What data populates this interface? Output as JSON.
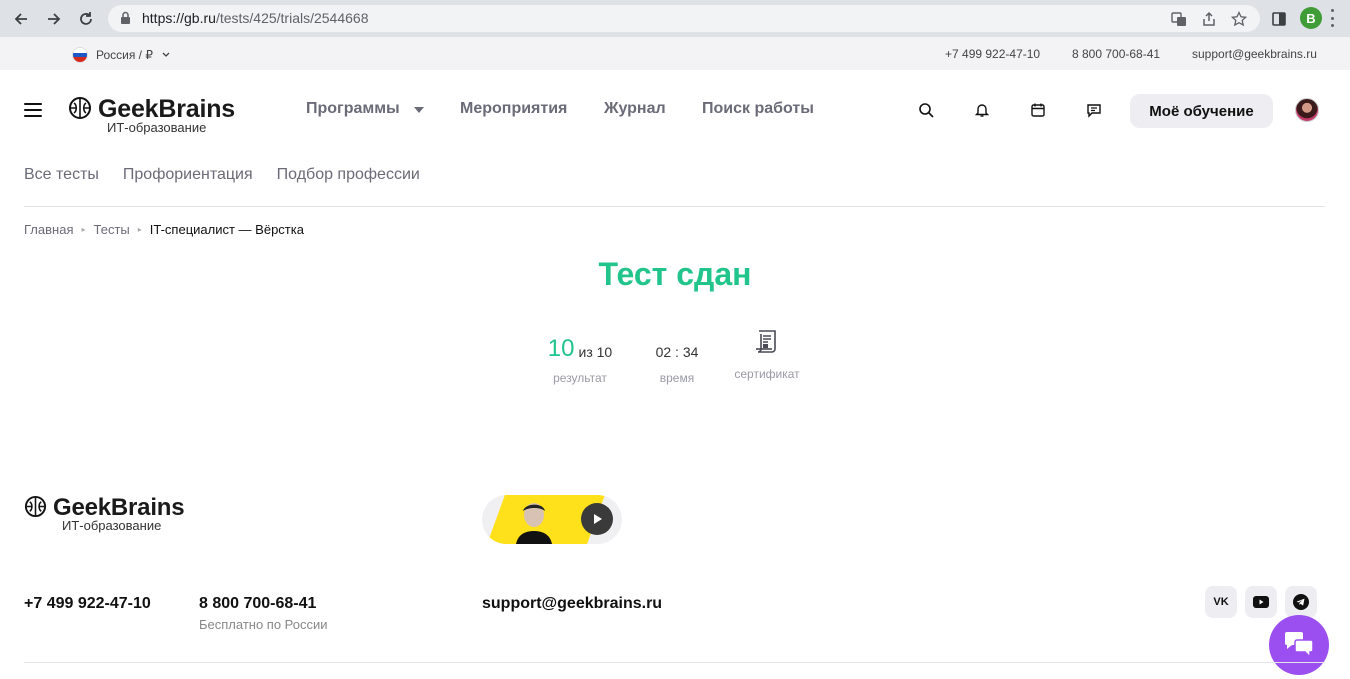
{
  "browser": {
    "url_host": "https://gb.ru",
    "url_path": "/tests/425/trials/2544668",
    "profile_initial": "B",
    "profile_color": "#3f9c36"
  },
  "topbar": {
    "region": "Россия / ₽",
    "phone1": "+7 499 922-47-10",
    "phone2": "8 800 700-68-41",
    "email": "support@geekbrains.ru"
  },
  "header": {
    "logo_name": "GeekBrains",
    "logo_tagline": "ИТ-образование",
    "nav": [
      "Программы",
      "Мероприятия",
      "Журнал",
      "Поиск работы"
    ],
    "my_learning": "Моё обучение",
    "icons": [
      "search-icon",
      "bell-icon",
      "calendar-icon",
      "message-icon"
    ]
  },
  "subnav": [
    "Все тесты",
    "Профориентация",
    "Подбор профессии"
  ],
  "breadcrumb": {
    "home": "Главная",
    "tests": "Тесты",
    "current": "IT-специалист — Вёрстка"
  },
  "result": {
    "title": "Тест сдан",
    "score": "10",
    "score_total": "из 10",
    "score_label": "результат",
    "time": "02 : 34",
    "time_label": "время",
    "certificate_label": "сертификат",
    "accent_color": "#21c48b"
  },
  "footer": {
    "logo_name": "GeekBrains",
    "logo_tagline": "ИТ-образование",
    "phone1": "+7 499 922-47-10",
    "phone2": "8 800 700-68-41",
    "phone2_note": "Бесплатно по России",
    "email": "support@geekbrains.ru",
    "social": [
      "vk-icon",
      "youtube-icon",
      "telegram-icon"
    ],
    "social_vk_label": "VK",
    "chat_color": "#9c4ff0"
  }
}
